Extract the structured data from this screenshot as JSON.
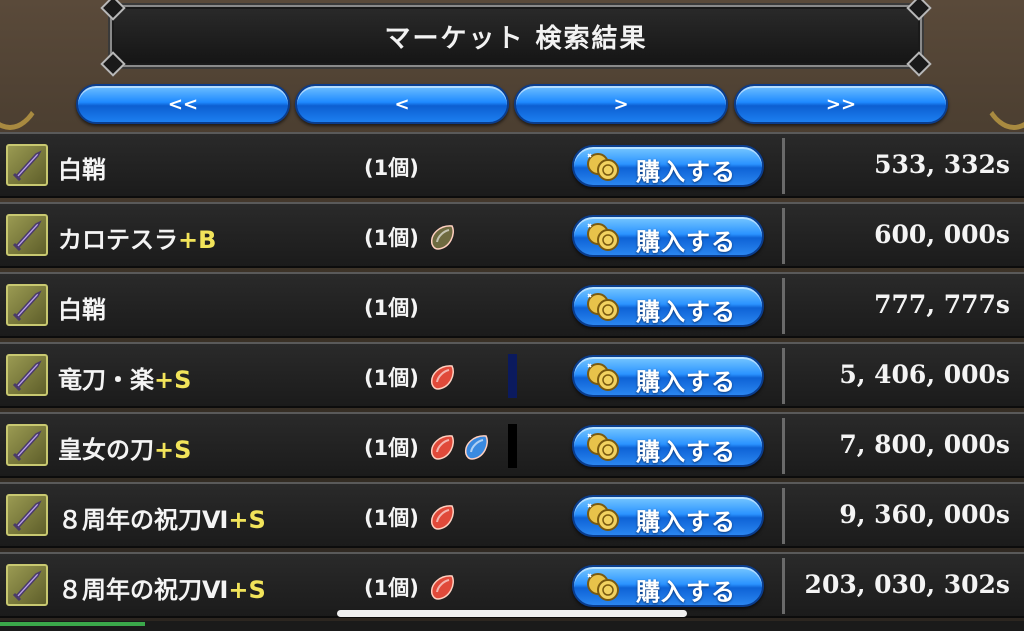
{
  "header": {
    "title": "マーケット 検索結果"
  },
  "pager": {
    "first": "<<",
    "prev": "<",
    "next": ">",
    "last": ">>"
  },
  "buy_label": "購入する",
  "colors": {
    "grade": "#f2e45a",
    "red_gem": "#e04a3a",
    "blue_gem": "#3a8ae0",
    "olive_gem": "#6e6a40",
    "button_blue": "#1f8aff"
  },
  "items": [
    {
      "name": "白鞘",
      "grade": "",
      "qty": "(1個)",
      "gems": [],
      "slot_mark": "",
      "price": "533, 332s"
    },
    {
      "name": "カロテスラ",
      "grade": "+B",
      "qty": "(1個)",
      "gems": [
        "olive"
      ],
      "slot_mark": "",
      "price": "600, 000s"
    },
    {
      "name": "白鞘",
      "grade": "",
      "qty": "(1個)",
      "gems": [],
      "slot_mark": "",
      "price": "777, 777s"
    },
    {
      "name": "竜刀・楽",
      "grade": "+S",
      "qty": "(1個)",
      "gems": [
        "red"
      ],
      "slot_mark": "#0b1a5e",
      "price": "5, 406, 000s"
    },
    {
      "name": "皇女の刀",
      "grade": "+S",
      "qty": "(1個)",
      "gems": [
        "red",
        "blue"
      ],
      "slot_mark": "#000000",
      "price": "7, 800, 000s"
    },
    {
      "name": "８周年の祝刀Ⅵ",
      "grade": "+S",
      "qty": "(1個)",
      "gems": [
        "red"
      ],
      "slot_mark": "",
      "price": "9, 360, 000s"
    },
    {
      "name": "８周年の祝刀Ⅵ",
      "grade": "+S",
      "qty": "(1個)",
      "gems": [
        "red"
      ],
      "slot_mark": "",
      "price": "203, 030, 302s"
    }
  ]
}
